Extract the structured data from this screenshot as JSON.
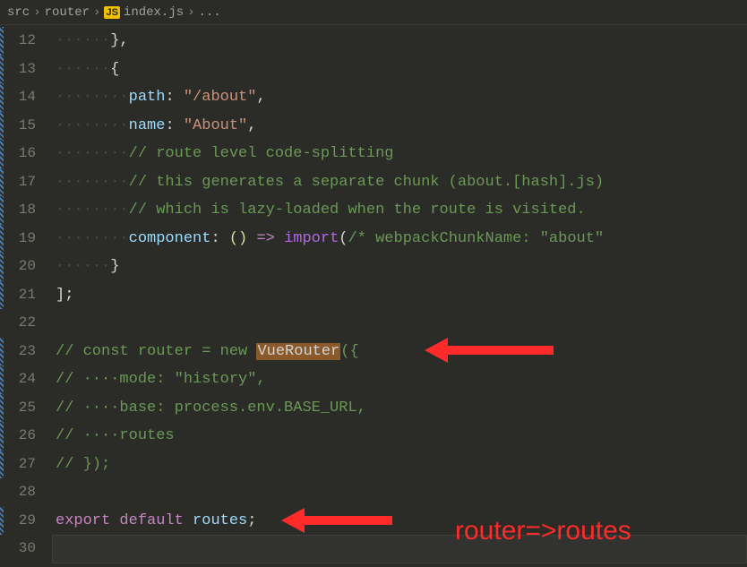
{
  "breadcrumb": {
    "seg1": "src",
    "seg2": "router",
    "iconLabel": "JS",
    "seg3": "index.js",
    "seg4": "..."
  },
  "gutter": [
    "12",
    "13",
    "14",
    "15",
    "16",
    "17",
    "18",
    "19",
    "20",
    "21",
    "22",
    "23",
    "24",
    "25",
    "26",
    "27",
    "28",
    "29",
    "30"
  ],
  "gutterMod": [
    true,
    true,
    true,
    true,
    true,
    true,
    true,
    true,
    true,
    true,
    false,
    true,
    true,
    true,
    true,
    true,
    false,
    true,
    false
  ],
  "annotation": "router=>routes",
  "code": {
    "l12a": "······",
    "l12b": "},",
    "l13a": "······",
    "l13b": "{",
    "l14a": "········",
    "l14k": "path",
    "l14c": ": ",
    "l14s": "\"/about\"",
    "l14p": ",",
    "l15a": "········",
    "l15k": "name",
    "l15c": ": ",
    "l15s": "\"About\"",
    "l15p": ",",
    "l16a": "········",
    "l16c": "// route level code-splitting",
    "l17a": "········",
    "l17c": "// this generates a separate chunk (about.[hash].js)",
    "l18a": "········",
    "l18c": "// which is lazy-loaded when the route is visited.",
    "l19a": "········",
    "l19k": "component",
    "l19c": ": ",
    "l19p1": "() ",
    "l19arrow": "=>",
    "l19sp": " ",
    "l19imp": "import",
    "l19p2": "(",
    "l19jc": "/* webpackChunkName: \"about\"",
    "l20a": "······",
    "l20b": "}",
    "l21": "];",
    "l22": "",
    "l23a": "// const router = new ",
    "l23h": "VueRouter",
    "l23b": "({",
    "l24": "// ····mode: \"history\",",
    "l25": "// ····base: process.env.BASE_URL,",
    "l26": "// ····routes",
    "l27": "// });",
    "l28": "",
    "l29a": "export",
    "l29sp1": " ",
    "l29b": "default",
    "l29sp2": " ",
    "l29v": "routes",
    "l29p": ";",
    "l30": ""
  }
}
